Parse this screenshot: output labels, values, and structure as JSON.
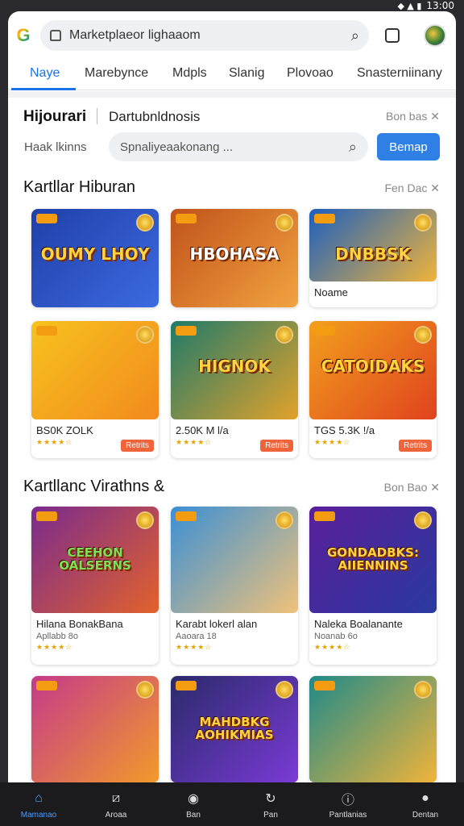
{
  "status": {
    "time": "13:00"
  },
  "browser": {
    "url": "Marketplaeor lighaaom",
    "tabs": [
      "Naye",
      "Marebynce",
      "Mdpls",
      "Slanig",
      "Plovoao",
      "Snasterniinany"
    ]
  },
  "header": {
    "title": "Hijourari",
    "subtitle": "Dartubnldnosis",
    "link": "Bon bas ✕"
  },
  "search": {
    "filter_label": "Haak lkinns",
    "placeholder": "Spnaliyeaakonang ...",
    "button": "Bemap"
  },
  "section1": {
    "title": "Kartllar Hiburan",
    "link": "Fen Dac ✕",
    "cards": [
      {
        "thumb_text": "OUMY LHOY",
        "name": "",
        "meta": "",
        "stars": "",
        "button": "",
        "colors": [
          "#1f3fa8",
          "#3d6ae0"
        ],
        "text_color": "#ffd23f"
      },
      {
        "thumb_text": "HBOHASA",
        "name": "",
        "meta": "",
        "stars": "",
        "button": "",
        "colors": [
          "#c0521a",
          "#f2a340"
        ],
        "text_color": "#fff"
      },
      {
        "thumb_text": "DNBBSK",
        "name": "Noame",
        "meta": "",
        "stars": "",
        "button": "",
        "colors": [
          "#1b5fbf",
          "#f0b43a"
        ],
        "text_color": "#ffd23f"
      },
      {
        "thumb_text": "",
        "name": "BS0K ZOLK",
        "meta": "",
        "stars": "★★★★☆",
        "button": "Retrits",
        "colors": [
          "#f7c21e",
          "#f28a1e"
        ],
        "text_color": "#fff"
      },
      {
        "thumb_text": "HIGNOK",
        "name": "2.50K M l/a",
        "meta": "",
        "stars": "★★★★☆",
        "button": "Retrits",
        "colors": [
          "#1f7a6a",
          "#e2a22b"
        ],
        "text_color": "#ffd23f"
      },
      {
        "thumb_text": "CATOIDAKS",
        "name": "TGS 5.3K !/a",
        "meta": "",
        "stars": "★★★★☆",
        "button": "Retrits",
        "colors": [
          "#f29f1e",
          "#e0421e"
        ],
        "text_color": "#ffd23f"
      }
    ]
  },
  "section2": {
    "title": "Kartllanc Virathns &",
    "link": "Bon Bao ✕",
    "cards": [
      {
        "thumb_text": "CEEHON OALSERNS",
        "name": "Hilana BonakBana",
        "meta": "Apllabb 8o",
        "stars": "★★★★☆",
        "colors": [
          "#7a2a8f",
          "#e2622b"
        ],
        "text_color": "#7be05a"
      },
      {
        "thumb_text": "",
        "name": "Karabt lokerl alan",
        "meta": "Aaoara 18",
        "stars": "★★★★☆",
        "colors": [
          "#3a8fd6",
          "#f0c27a"
        ],
        "text_color": "#fff"
      },
      {
        "thumb_text": "GONDADBKS: AIIENNINS",
        "name": "Naleka Boalanante",
        "meta": "Noanab 6o",
        "stars": "★★★★☆",
        "colors": [
          "#5a1f9a",
          "#2a3a9f"
        ],
        "text_color": "#ffd23f"
      },
      {
        "thumb_text": "",
        "name": "",
        "meta": "",
        "stars": "",
        "colors": [
          "#c43a8a",
          "#f29a2b"
        ],
        "text_color": "#fff"
      },
      {
        "thumb_text": "MAHDBKG AOHIKMIAS",
        "name": "",
        "meta": "",
        "stars": "",
        "colors": [
          "#2a2a6a",
          "#7a3ad6"
        ],
        "text_color": "#ffd23f"
      },
      {
        "thumb_text": "",
        "name": "",
        "meta": "",
        "stars": "",
        "colors": [
          "#1f8a8a",
          "#f0b43a"
        ],
        "text_color": "#fff"
      }
    ]
  },
  "bottom_nav": [
    {
      "label": "Mamanao",
      "icon": "home-icon",
      "glyph": "⌂",
      "active": true
    },
    {
      "label": "Aroaa",
      "icon": "edit-icon",
      "glyph": "⧄",
      "active": false
    },
    {
      "label": "Ban",
      "icon": "disc-icon",
      "glyph": "◉",
      "active": false
    },
    {
      "label": "Pan",
      "icon": "refresh-icon",
      "glyph": "↻",
      "active": false
    },
    {
      "label": "Pantlanias",
      "icon": "info-icon",
      "glyph": "ⓘ",
      "active": false
    },
    {
      "label": "Dentan",
      "icon": "user-icon",
      "glyph": "●",
      "active": false
    }
  ]
}
